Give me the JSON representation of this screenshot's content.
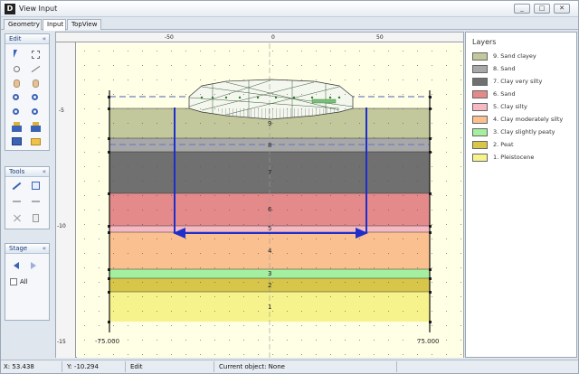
{
  "window": {
    "title": "View Input",
    "min_label": "_",
    "max_label": "□",
    "close_label": "✕"
  },
  "tabs": [
    {
      "label": "Geometry"
    },
    {
      "label": "Input"
    },
    {
      "label": "TopView"
    }
  ],
  "left_panels": {
    "edit": {
      "title": "Edit",
      "collapse": "«"
    },
    "tools": {
      "title": "Tools",
      "collapse": "«"
    },
    "stage": {
      "title": "Stage",
      "collapse": "«",
      "all_label": "All"
    }
  },
  "ruler": {
    "top_labels": [
      "-50",
      "0",
      "50"
    ],
    "left_labels": [
      "-5",
      "-10",
      "-15"
    ]
  },
  "layers_panel": {
    "title": "Layers"
  },
  "layers": [
    {
      "label": "9. Sand clayey",
      "color": "#c2c89b"
    },
    {
      "label": "8. Sand",
      "color": "#a8a8a8"
    },
    {
      "label": "7. Clay very silty",
      "color": "#707070"
    },
    {
      "label": "6. Sand",
      "color": "#e58a8a"
    },
    {
      "label": "5. Clay silty",
      "color": "#f5b9c4"
    },
    {
      "label": "4. Clay moderately silty",
      "color": "#fbc08f"
    },
    {
      "label": "3. Clay slightly peaty",
      "color": "#a5f0a0"
    },
    {
      "label": "2. Peat",
      "color": "#d7c64a"
    },
    {
      "label": "1. Pleistocene",
      "color": "#f7f38c"
    }
  ],
  "section": {
    "layer_numbers": [
      "9",
      "8",
      "7",
      "6",
      "5",
      "4",
      "3",
      "2",
      "1"
    ],
    "left_coord": "-75.000",
    "right_coord": "75.000",
    "accent": "#1e2ecb"
  },
  "status": {
    "x": "X: 53.438",
    "y": "Y: -10.294",
    "mode": "Edit",
    "current": "Current object: None"
  }
}
